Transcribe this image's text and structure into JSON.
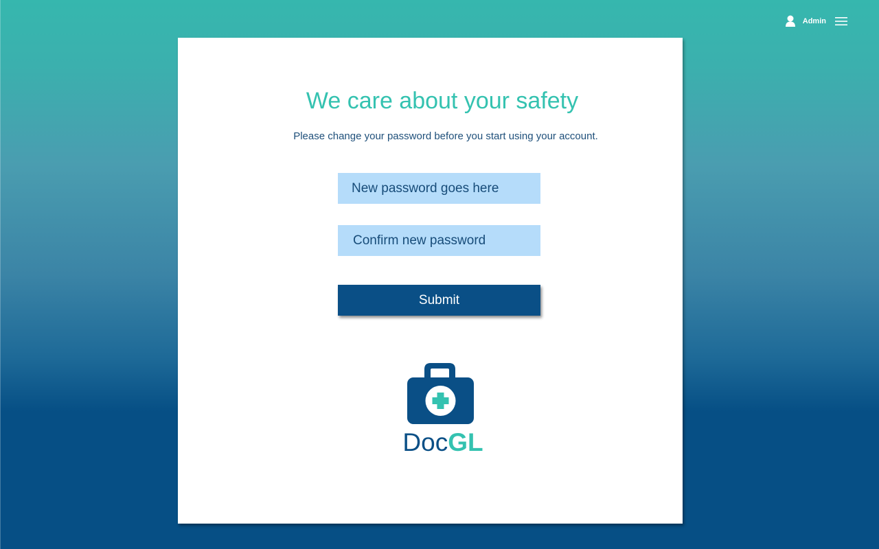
{
  "header": {
    "user_icon": "user-icon",
    "user_label": "Admin",
    "menu_icon": "hamburger-menu-icon"
  },
  "form": {
    "title": "We care about your safety",
    "subtitle": "Please change your password before you start using your account.",
    "new_password_placeholder": "New password goes here",
    "confirm_password_placeholder": "Confirm new password",
    "submit_label": "Submit"
  },
  "logo": {
    "icon": "medical-kit-icon",
    "text_part1": "Doc",
    "text_part2": "GL"
  },
  "colors": {
    "accent": "#34c2b0",
    "brand_dark": "#0a4f86",
    "input_bg": "#b5dcfa",
    "card_bg": "#ffffff",
    "bg_top": "#36b7ae",
    "bg_bottom": "#064f85"
  }
}
